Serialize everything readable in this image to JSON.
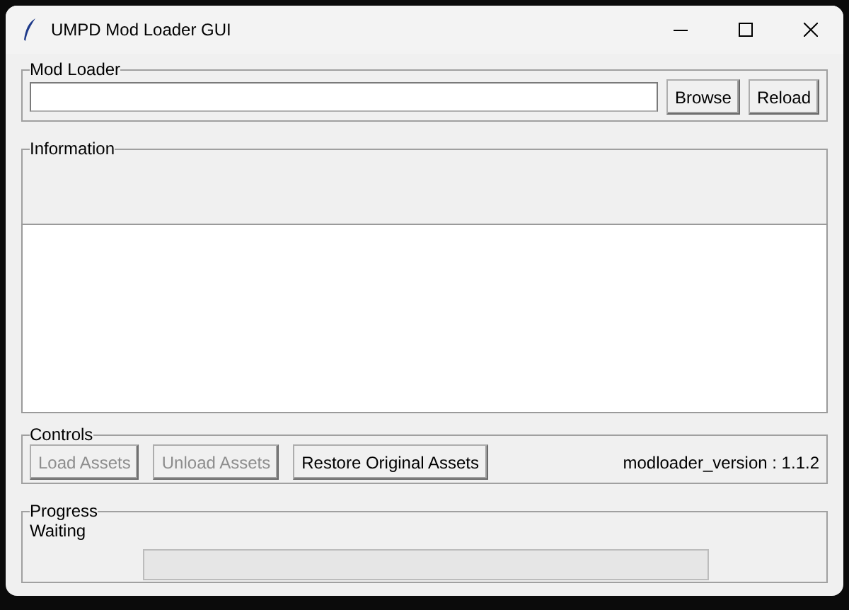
{
  "window": {
    "title": "UMPD Mod Loader GUI"
  },
  "mod_loader": {
    "label": "Mod Loader",
    "buttons": [
      {
        "label": "Browse",
        "disabled": false
      },
      {
        "label": "Reload",
        "disabled": false
      }
    ]
  },
  "information": {
    "label": "Information"
  },
  "controls": {
    "label": "Controls",
    "buttons": [
      {
        "label": "Load Assets",
        "disabled": true
      },
      {
        "label": "Unload Assets",
        "disabled": true
      },
      {
        "label": "Restore Original Assets",
        "disabled": false
      }
    ],
    "version": "modloader_version : 1.1.2"
  },
  "progress": {
    "label": "Progress",
    "status": "Waiting",
    "level": 0
  }
}
